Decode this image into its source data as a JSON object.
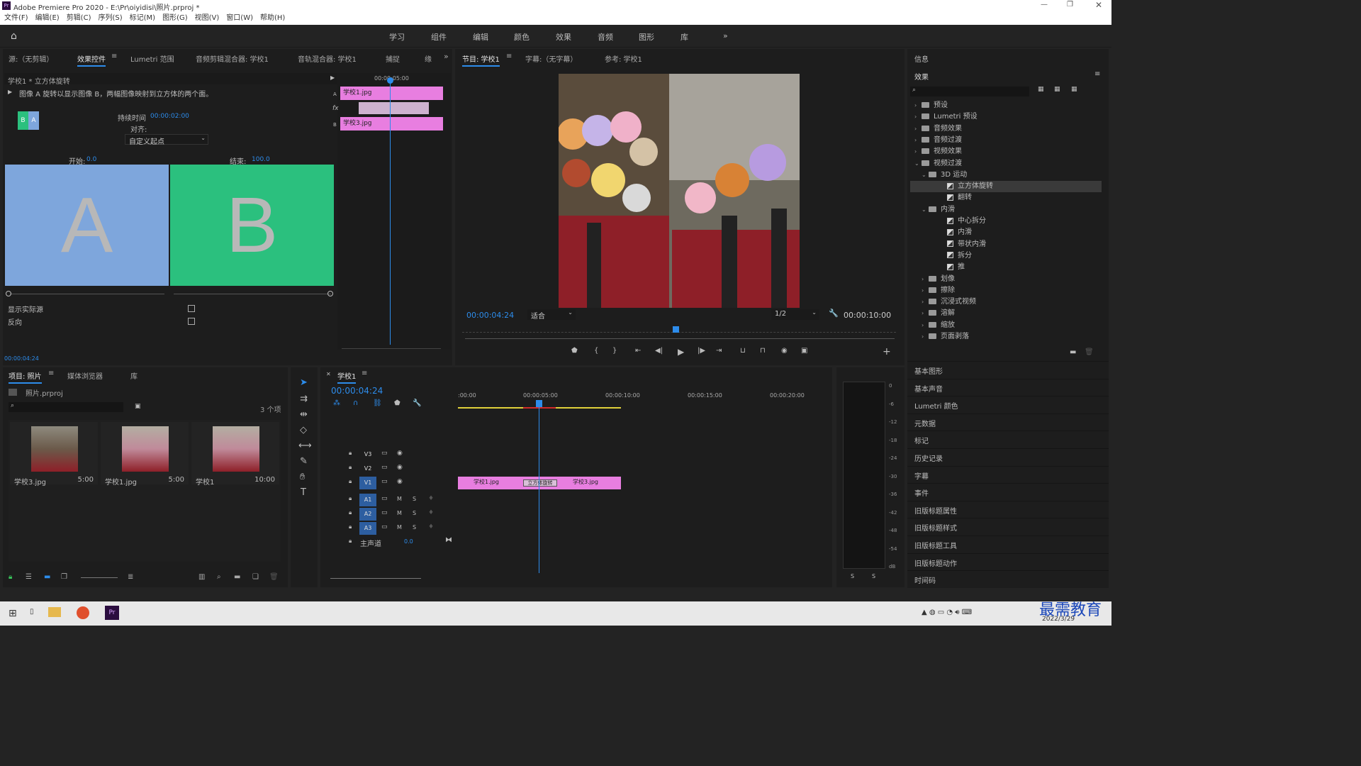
{
  "window": {
    "title": "Adobe Premiere Pro 2020 - E:\\Pr\\oiyidisi\\照片.prproj *",
    "app_icon": "Pr"
  },
  "menu": [
    "文件(F)",
    "编辑(E)",
    "剪辑(C)",
    "序列(S)",
    "标记(M)",
    "图形(G)",
    "视图(V)",
    "窗口(W)",
    "帮助(H)"
  ],
  "workspaces": [
    "学习",
    "组件",
    "编辑",
    "颜色",
    "效果",
    "音频",
    "图形",
    "库"
  ],
  "source_tabs": [
    "源:（无剪辑）",
    "效果控件",
    "Lumetri 范围",
    "音频剪辑混合器: 学校1",
    "音轨混合器: 学校1",
    "捕捉",
    "缘"
  ],
  "effect_controls": {
    "clip": "学校1 * 立方体旋转",
    "description": "图像 A 旋转以显示图像 B，两幅图像映射到立方体的两个面。",
    "duration_label": "持续时间",
    "duration": "00:00:02:00",
    "align_label": "对齐:",
    "align_value": "自定义起点",
    "start_label": "开始:",
    "start_value": "0.0",
    "end_label": "结束:",
    "end_value": "100.0",
    "thumb_a": "A",
    "thumb_b": "B",
    "show_actual": "显示实际源",
    "reverse": "反向",
    "timecode": "00:00:04:24",
    "mini_time": "00:00:05:00",
    "mini_clip1": "学校1.jpg",
    "mini_clip2": "学校3.jpg",
    "mini_a": "A",
    "mini_b": "B",
    "mini_fx": "fx"
  },
  "program": {
    "tabs": [
      "节目: 学校1",
      "字幕:（无字幕）",
      "参考: 学校1"
    ],
    "timecode": "00:00:04:24",
    "fit": "适合",
    "res": "1/2",
    "duration": "00:00:10:00"
  },
  "right": {
    "info": "信息",
    "effects": "效果",
    "tree": [
      {
        "label": "预设",
        "level": 0,
        "type": "folder",
        "open": false
      },
      {
        "label": "Lumetri 预设",
        "level": 0,
        "type": "folder",
        "open": false
      },
      {
        "label": "音频效果",
        "level": 0,
        "type": "folder",
        "open": false
      },
      {
        "label": "音频过渡",
        "level": 0,
        "type": "folder",
        "open": false
      },
      {
        "label": "视频效果",
        "level": 0,
        "type": "folder",
        "open": false
      },
      {
        "label": "视频过渡",
        "level": 0,
        "type": "folder",
        "open": true
      },
      {
        "label": "3D 运动",
        "level": 1,
        "type": "folder",
        "open": true
      },
      {
        "label": "立方体旋转",
        "level": 2,
        "type": "fx",
        "selected": true
      },
      {
        "label": "翻转",
        "level": 2,
        "type": "fx"
      },
      {
        "label": "内滑",
        "level": 1,
        "type": "folder",
        "open": true
      },
      {
        "label": "中心拆分",
        "level": 2,
        "type": "fx"
      },
      {
        "label": "内滑",
        "level": 2,
        "type": "fx"
      },
      {
        "label": "带状内滑",
        "level": 2,
        "type": "fx"
      },
      {
        "label": "拆分",
        "level": 2,
        "type": "fx"
      },
      {
        "label": "推",
        "level": 2,
        "type": "fx"
      },
      {
        "label": "划像",
        "level": 1,
        "type": "folder",
        "open": false
      },
      {
        "label": "擦除",
        "level": 1,
        "type": "folder",
        "open": false
      },
      {
        "label": "沉浸式视频",
        "level": 1,
        "type": "folder",
        "open": false
      },
      {
        "label": "溶解",
        "level": 1,
        "type": "folder",
        "open": false
      },
      {
        "label": "缩放",
        "level": 1,
        "type": "folder",
        "open": false
      },
      {
        "label": "页面剥落",
        "level": 1,
        "type": "folder",
        "open": false
      }
    ],
    "panels": [
      "基本图形",
      "基本声音",
      "Lumetri 颜色",
      "元数据",
      "标记",
      "历史记录",
      "字幕",
      "事件",
      "旧版标题属性",
      "旧版标题样式",
      "旧版标题工具",
      "旧版标题动作",
      "时间码"
    ]
  },
  "project": {
    "tabs": [
      "项目: 照片",
      "媒体浏览器",
      "库"
    ],
    "file": "照片.prproj",
    "count": "3 个项",
    "items": [
      {
        "name": "学校3.jpg",
        "dur": "5:00"
      },
      {
        "name": "学校1.jpg",
        "dur": "5:00"
      },
      {
        "name": "学校1",
        "dur": "10:00"
      }
    ]
  },
  "timeline": {
    "tab": "学校1",
    "timecode": "00:00:04:24",
    "ruler": [
      ":00:00",
      "00:00:05:00",
      "00:00:10:00",
      "00:00:15:00",
      "00:00:20:00"
    ],
    "tracks": [
      "V3",
      "V2",
      "V1",
      "A1",
      "A2",
      "A3"
    ],
    "master": "主声道",
    "master_val": "0.0",
    "clip1": "学校1.jpg",
    "clip2": "学校3.jpg",
    "transition": "立方体旋转"
  },
  "meter": {
    "scale": [
      "0",
      "-6",
      "-12",
      "-18",
      "-24",
      "-30",
      "-36",
      "-42",
      "-48",
      "-54",
      "dB"
    ],
    "s": "S"
  },
  "taskbar": {
    "date": "2022/3/29",
    "watermark": "最需教育"
  },
  "colors": {
    "accent": "#2d8ceb",
    "clip": "#e87ee0",
    "a": "#7ea6dc",
    "b": "#2bc07e"
  }
}
